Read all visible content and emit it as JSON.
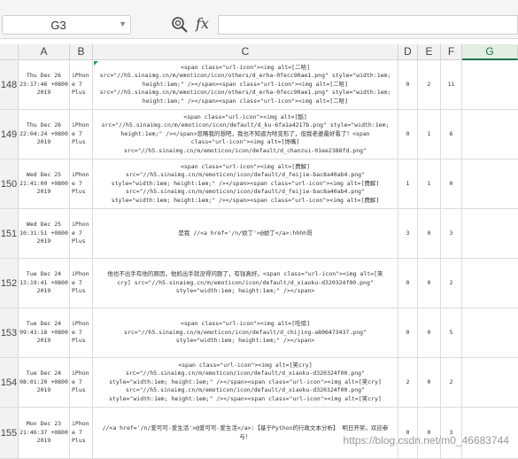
{
  "formula_bar": {
    "name_box": "G3",
    "fx_label": "fx"
  },
  "columns": [
    "A",
    "B",
    "C",
    "D",
    "E",
    "F",
    "G"
  ],
  "active_column": "G",
  "rows": [
    {
      "num": "148",
      "a": "Thu Dec 26\n23:17:46 +0800\n2019",
      "b": "iPhon\ne 7\nPlus",
      "c": "<span class=\"url-icon\"><img alt=[二哈]\nsrc=\"//h5.sinaimg.cn/m/emoticon/icon/others/d_erha-0fecc90ae1.png\" style=\"width:1em;\nheight:1em;\" /></span><span class=\"url-icon\"><img alt=[二哈]\nsrc=\"//h5.sinaimg.cn/m/emoticon/icon/others/d_erha-0fecc90ae1.png\" style=\"width:1em;\nheight:1em;\" /></span><span class=\"url-icon\"><img alt=[二哈]",
      "d": "0",
      "e": "2",
      "f": "11"
    },
    {
      "num": "149",
      "a": "Thu Dec 26\n22:04:24 +0800\n2019",
      "b": "iPhon\ne 7\nPlus",
      "c": "<span class=\"url-icon\"><img alt=[酷]\nsrc=\"//h5.sinaimg.cn/m/emoticon/icon/default/d_ku-6fa1a4217b.png\" style=\"width:1em;\nheight:1em;\" /></span>忽略我的想吧，我也不知道为啥变形了，但我老婆最好看了！<span\nclass=\"url-icon\"><img alt=[馋嘴]\nsrc=\"//h5.sinaimg.cn/m/emoticon/icon/default/d_chanzui-01ee2388fd.png\"",
      "d": "0",
      "e": "1",
      "f": "6"
    },
    {
      "num": "150",
      "a": "Wed Dec 25\n21:41:00 +0800\n2019",
      "b": "iPhon\ne 7\nPlus",
      "c": "<span class=\"url-icon\"><img alt=[费解]\nsrc=\"//h5.sinaimg.cn/m/emoticon/icon/default/d_feijie-bac8a40ab4.png\"\nstyle=\"width:1em; height:1em;\" /></span><span class=\"url-icon\"><img alt=[费解]\nsrc=\"//h5.sinaimg.cn/m/emoticon/icon/default/d_feijie-bac8a40ab4.png\"\nstyle=\"width:1em; height:1em;\" /></span><span class=\"url-icon\"><img alt=[费解]",
      "d": "1",
      "e": "1",
      "f": "0"
    },
    {
      "num": "151",
      "a": "Wed Dec 25\n10:31:51 +0800\n2019",
      "b": "iPhon\ne 7\nPlus",
      "c": "是我 //<a href='/n/蚊丁'>@蚊丁</a>:hhhh哥",
      "d": "3",
      "e": "0",
      "f": "3"
    },
    {
      "num": "152",
      "a": "Tue Dec 24\n13:19:41 +0800\n2019",
      "b": "iPhon\ne 7\nPlus",
      "c": "他也不出手有他的原因，他妈出手就没得问题了，有钱真好。<span class=\"url-icon\"><img alt=[笑\ncry] src=\"//h5.sinaimg.cn/m/emoticon/icon/default/d_xiaoku-d320324f00.png\"\nstyle=\"width:1em; height:1em;\" /></span>",
      "d": "0",
      "e": "0",
      "f": "2"
    },
    {
      "num": "153",
      "a": "Tue Dec 24\n09:43:18 +0800\n2019",
      "b": "iPhon\ne 7\nPlus",
      "c": "<span class=\"url-icon\"><img alt=[吃惊]\nsrc=\"//h5.sinaimg.cn/m/emoticon/icon/default/d_chijing-a806473437.png\"\nstyle=\"width:1em; height:1em;\" /></span>",
      "d": "0",
      "e": "0",
      "f": "5"
    },
    {
      "num": "154",
      "a": "Tue Dec 24\n08:01:20 +0800\n2019",
      "b": "iPhon\ne 7\nPlus",
      "c": "<span class=\"url-icon\"><img alt=[笑cry]\nsrc=\"//h5.sinaimg.cn/m/emoticon/icon/default/d_xiaoku-d320324f00.png\"\nstyle=\"width:1em; height:1em;\" /></span><span class=\"url-icon\"><img alt=[笑cry]\nsrc=\"//h5.sinaimg.cn/m/emoticon/icon/default/d_xiaoku-d320324f00.png\"\nstyle=\"width:1em; height:1em;\" /></span><span class=\"url-icon\"><img alt=[笑cry]",
      "d": "2",
      "e": "0",
      "f": "2"
    },
    {
      "num": "155",
      "a": "Mon Dec 23\n21:46:37 +0800\n2019",
      "b": "iPhon\ne 7\nPlus",
      "c": "//<a href='/n/爱可可-爱生活'>@爱可可-爱生活</a>:【基于Python的行政文本分析】 明日开奖，欢迎参\n与！",
      "d": "0",
      "e": "0",
      "f": "3"
    }
  ],
  "watermark": "https://blog.csdn.net/m0_46683744"
}
